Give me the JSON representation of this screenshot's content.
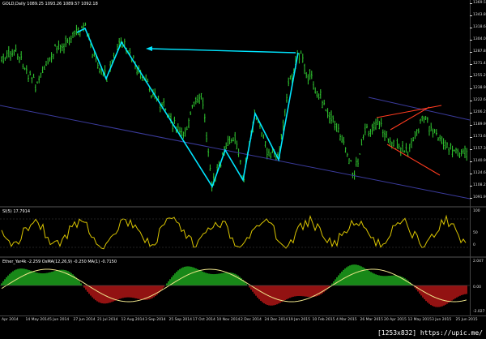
{
  "price_header": "GOLD,Daily  1089.25 1093.26 1089.57 1092.18",
  "si_header": "SI(5) 17.7914",
  "osma_header": "Ether_Yar4k -2.259   OsMA(12,26,9) -0.250   MA(1) -0.7150",
  "price_ticks": [
    "1369.5",
    "1343.8",
    "1318.6",
    "1304.0",
    "1287.8",
    "1271.4",
    "1255.2",
    "1238.9",
    "1222.6",
    "1206.2",
    "1189.9",
    "1173.6",
    "1157.3",
    "1140.9",
    "1124.6",
    "1108.2",
    "1091.9"
  ],
  "si_ticks": [
    "100",
    "50",
    "0"
  ],
  "osma_ticks": [
    "2.047",
    "0.00",
    "-2.027"
  ],
  "dates": [
    "Apr 2014",
    "14 May 2014",
    "5 Jun 2014",
    "27 Jun 2014",
    "21 Jul 2014",
    "12 Aug 2014",
    "3 Sep 2014",
    "25 Sep 2014",
    "17 Oct 2014",
    "10 Nov 2014",
    "2 Dec 2014",
    "24 Dec 2014",
    "19 Jan 2015",
    "10 Feb 2015",
    "4 Mar 2015",
    "26 Mar 2015",
    "20 Apr 2015",
    "12 May 2015",
    "3 Jun 2015",
    "25 Jun 2015"
  ],
  "colors": {
    "bull": "#32cd32",
    "bear": "#32cd32",
    "zigzag": "#00e5ff",
    "channel": "#3b3b9c",
    "wedge": "#ff3b1f",
    "si": "#d9c400",
    "osma_pos": "#22c322",
    "osma_neg": "#d11a1a",
    "signal": "#f0e68c"
  },
  "watermark": "[1253x832] https://upic.me/"
}
